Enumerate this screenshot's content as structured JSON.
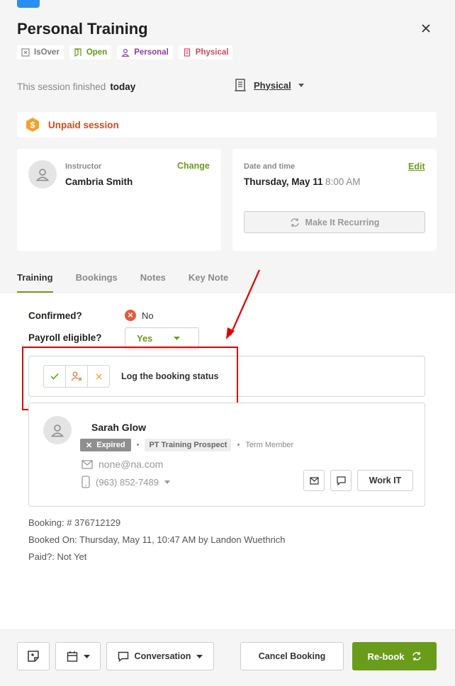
{
  "header": {
    "title": "Personal Training",
    "tags": [
      {
        "label": "IsOver",
        "icon": "x-square-icon",
        "color": "#7a7a7a"
      },
      {
        "label": "Open",
        "icon": "door-icon",
        "color": "#5e9b17"
      },
      {
        "label": "Personal",
        "icon": "person-icon",
        "color": "#8c3fa8"
      },
      {
        "label": "Physical",
        "icon": "building-icon",
        "color": "#d9455c"
      }
    ]
  },
  "session": {
    "finished_label": "This session finished",
    "finished_value": "today",
    "location_value": "Physical"
  },
  "alert": {
    "text": "Unpaid session",
    "icon": "dollar-hexagon-icon",
    "color": "#d24a1e"
  },
  "instructor": {
    "label": "Instructor",
    "name": "Cambria Smith",
    "action": "Change"
  },
  "datetime": {
    "label": "Date and time",
    "date": "Thursday, May 11",
    "time": "8:00 AM",
    "action": "Edit",
    "recurring_label": "Make It Recurring"
  },
  "tabs": [
    "Training",
    "Bookings",
    "Notes",
    "Key Note"
  ],
  "training": {
    "confirmed_label": "Confirmed?",
    "confirmed_value": "No",
    "payroll_label": "Payroll eligible?",
    "payroll_value": "Yes",
    "log_status_text": "Log the booking status"
  },
  "member": {
    "name": "Sarah Glow",
    "status_badge": "Expired",
    "type_badge": "PT Training Prospect",
    "membership": "Term Member",
    "email": "none@na.com",
    "phone": "(963) 852-7489",
    "work_it_label": "Work IT"
  },
  "booking_info": {
    "booking_number": "Booking: # 376712129",
    "booked_on": "Booked On: Thursday, May 11, 10:47 AM by Landon Wuethrich",
    "paid": "Paid?: Not Yet"
  },
  "footer": {
    "conversation_label": "Conversation",
    "cancel_label": "Cancel Booking",
    "rebook_label": "Re-book"
  },
  "colors": {
    "accent": "#6a9c1b",
    "annotation": "#e00000"
  }
}
